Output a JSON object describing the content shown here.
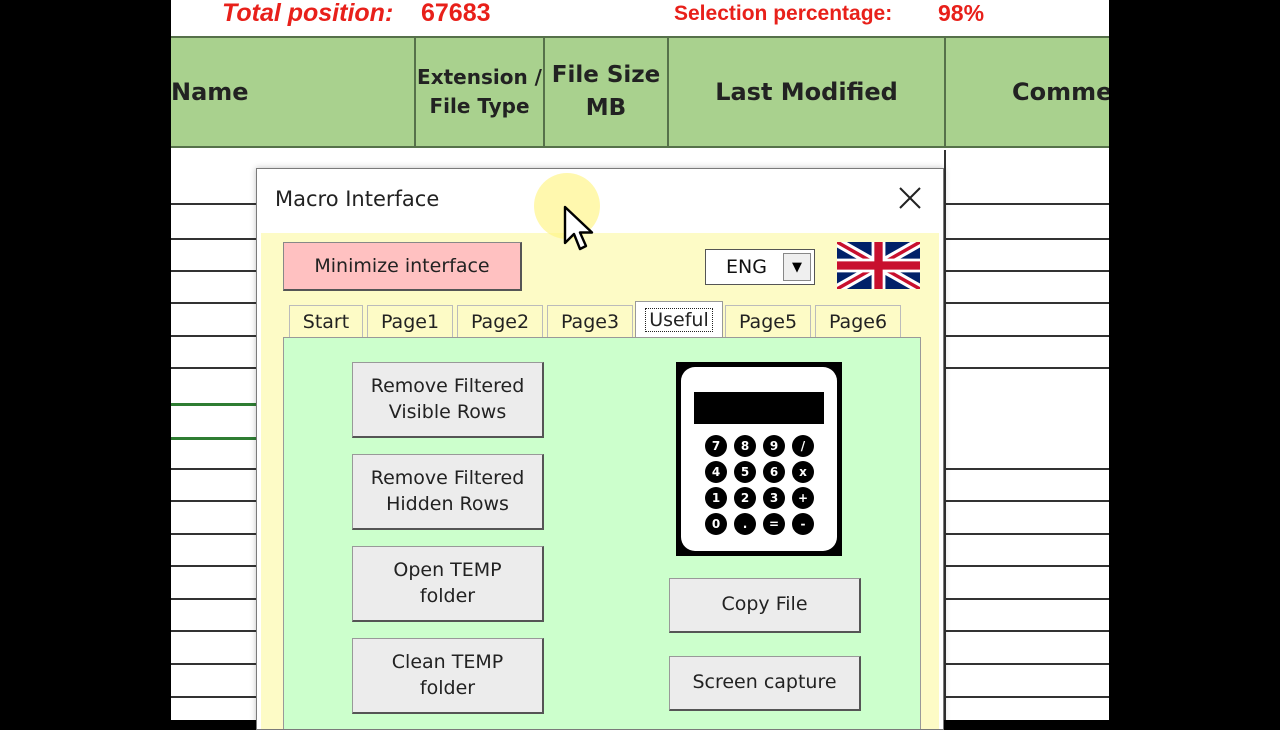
{
  "sheet": {
    "total_position_label": "Total position:",
    "total_position_value": "67683",
    "selection_label": "Selection percentage:",
    "selection_value": "98%",
    "columns": [
      "Name",
      "Extension / File Type",
      "File Size MB",
      "Last Modified",
      "Comme"
    ]
  },
  "dialog": {
    "title": "Macro Interface",
    "minimize_label": "Minimize interface",
    "language": "ENG",
    "tabs": [
      "Start",
      "Page1",
      "Page2",
      "Page3",
      "Useful",
      "Page5",
      "Page6"
    ],
    "active_tab": "Useful",
    "buttons_left": [
      "Remove Filtered Visible Rows",
      "Remove Filtered Hidden Rows",
      "Open TEMP folder",
      "Clean TEMP folder"
    ],
    "buttons_right": [
      "Copy File",
      "Screen capture"
    ],
    "calculator_keys": [
      "7",
      "8",
      "9",
      "/",
      "4",
      "5",
      "6",
      "x",
      "1",
      "2",
      "3",
      "+",
      "0",
      ".",
      "=",
      "-"
    ]
  },
  "colors": {
    "header_green": "#a9d18e",
    "alert_red": "#e8201a",
    "page_green": "#ccffcc",
    "dialog_yellow": "#fdfbc6",
    "minimize_pink": "#ffc1c1"
  }
}
